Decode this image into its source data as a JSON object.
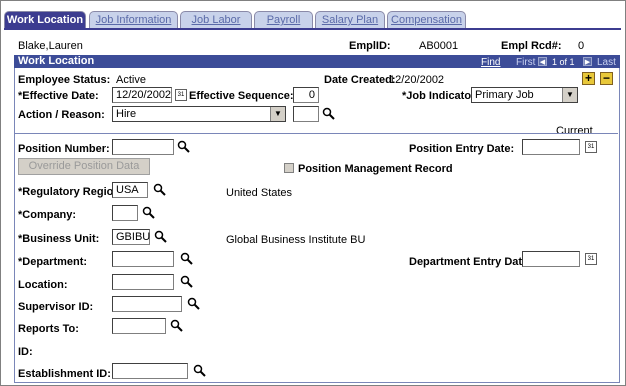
{
  "tabs": [
    {
      "label": "Work Location",
      "active": true
    },
    {
      "label": "Job Information",
      "active": false
    },
    {
      "label": "Job Labor",
      "active": false
    },
    {
      "label": "Payroll",
      "active": false
    },
    {
      "label": "Salary Plan",
      "active": false
    },
    {
      "label": "Compensation",
      "active": false
    }
  ],
  "employee": {
    "name": "Blake,Lauren",
    "emplid_label": "EmplID:",
    "emplid": "AB0001",
    "rcd_label": "Empl Rcd#:",
    "rcd": "0"
  },
  "section": {
    "title": "Work Location",
    "find": "Find",
    "first": "First",
    "count": "1 of 1",
    "last": "Last"
  },
  "status": {
    "label": "Employee Status:",
    "value": "Active"
  },
  "created": {
    "label": "Date Created:",
    "value": "12/20/2002"
  },
  "eff_date": {
    "label": "*Effective Date:",
    "value": "12/20/2002"
  },
  "eff_seq": {
    "label": "Effective Sequence:",
    "value": "0"
  },
  "job_indicator": {
    "label": "*Job Indicator:",
    "value": "Primary Job"
  },
  "action": {
    "label": "Action / Reason:",
    "value": "Hire",
    "reason": ""
  },
  "current_label": "Current",
  "position_number": {
    "label": "Position Number:",
    "value": ""
  },
  "position_entry_date": {
    "label": "Position Entry Date:",
    "value": ""
  },
  "override_button": "Override Position Data",
  "position_mgmt": {
    "label": "Position Management Record",
    "checked": false
  },
  "reg_region": {
    "label": "*Regulatory Region:",
    "value": "USA",
    "desc": "United States"
  },
  "company": {
    "label": "*Company:",
    "value": ""
  },
  "business_unit": {
    "label": "*Business Unit:",
    "value": "GBIBU",
    "desc": "Global Business Institute BU"
  },
  "department": {
    "label": "*Department:",
    "value": ""
  },
  "dept_entry_date": {
    "label": "Department Entry Date:",
    "value": ""
  },
  "location": {
    "label": "Location:",
    "value": ""
  },
  "supervisor": {
    "label": "Supervisor ID:",
    "value": ""
  },
  "reports_to": {
    "label": "Reports To:",
    "value": ""
  },
  "id_label": "ID:",
  "establishment": {
    "label": "Establishment ID:",
    "value": ""
  }
}
